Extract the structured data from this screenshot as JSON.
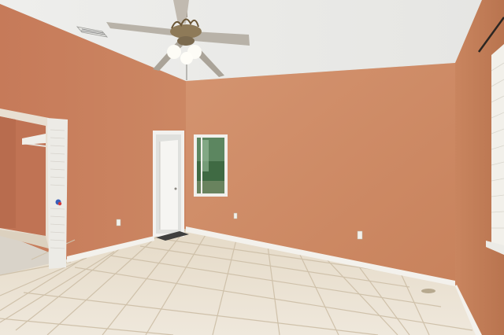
{
  "scene": {
    "kind": "empty-bedroom-photo",
    "colors": {
      "wall_left": "#c8805f",
      "wall_back": "#d08e66",
      "wall_right": "#c7825e",
      "ceiling": "#ececea",
      "floor_tile": "#e6dccb",
      "grout": "#cdbfa8",
      "baseboard": "#f3f1ec",
      "door_white": "#f4f3ef",
      "fan_metal": "#b8b2a8",
      "window_view": "#3f6a43"
    },
    "icons": [
      "ceiling-fan-icon",
      "air-vent-icon",
      "electrical-outlet-icon"
    ]
  }
}
